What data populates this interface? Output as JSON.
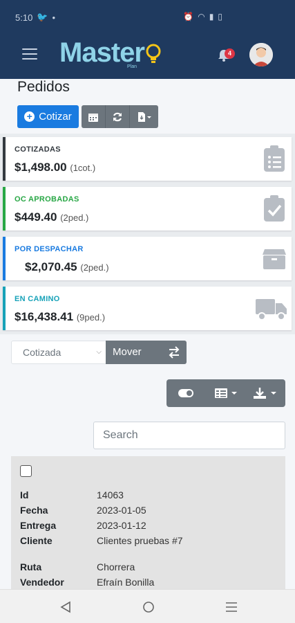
{
  "status_bar": {
    "time": "5:10"
  },
  "header": {
    "logo_text": "Master",
    "logo_sub": "Plan",
    "notification_count": "4"
  },
  "page": {
    "title": "Pedidos"
  },
  "toolbar": {
    "cotizar_label": "Cotizar"
  },
  "cards": [
    {
      "title": "COTIZADAS",
      "amount": "$1,498.00",
      "sub": "(1cot.)",
      "color": "#343a40"
    },
    {
      "title": "OC APROBADAS",
      "amount": "$449.40",
      "sub": "(2ped.)",
      "color": "#28a745"
    },
    {
      "title": "POR DESPACHAR",
      "amount": "$2,070.45",
      "sub": "(2ped.)",
      "color": "#1a7be0"
    },
    {
      "title": "EN CAMINO",
      "amount": "$16,438.41",
      "sub": "(9ped.)",
      "color": "#17a2b8"
    }
  ],
  "move": {
    "select_value": "Cotizada",
    "button_label": "Mover"
  },
  "search": {
    "placeholder": "Search"
  },
  "record": {
    "fields": [
      {
        "key": "Id",
        "value": "14063"
      },
      {
        "key": "Fecha",
        "value": "2023-01-05"
      },
      {
        "key": "Entrega",
        "value": "2023-01-12"
      },
      {
        "key": "Cliente",
        "value": "Clientes pruebas #7"
      },
      {
        "key": "Ruta",
        "value": "Chorrera"
      },
      {
        "key": "Vendedor",
        "value": "Efraín Bonilla"
      }
    ]
  }
}
